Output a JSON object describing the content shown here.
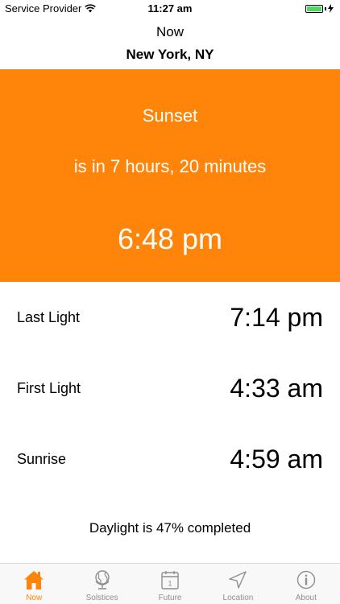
{
  "status_bar": {
    "carrier": "Service Provider",
    "time": "11:27 am"
  },
  "header": {
    "title": "Now",
    "location": "New York, NY"
  },
  "hero": {
    "event": "Sunset",
    "countdown": "is in 7 hours, 20 minutes",
    "time": "6:48 pm",
    "color": "#ff840a"
  },
  "rows": [
    {
      "label": "Last Light",
      "value": "7:14 pm"
    },
    {
      "label": "First Light",
      "value": "4:33 am"
    },
    {
      "label": "Sunrise",
      "value": "4:59 am"
    }
  ],
  "daylight": {
    "text": "Daylight is 47% completed",
    "percent": 47
  },
  "tabs": [
    {
      "label": "Now",
      "icon": "house-icon",
      "active": true
    },
    {
      "label": "Solstices",
      "icon": "globe-icon",
      "active": false
    },
    {
      "label": "Future",
      "icon": "calendar-icon",
      "active": false
    },
    {
      "label": "Location",
      "icon": "location-arrow-icon",
      "active": false
    },
    {
      "label": "About",
      "icon": "info-icon",
      "active": false
    }
  ]
}
